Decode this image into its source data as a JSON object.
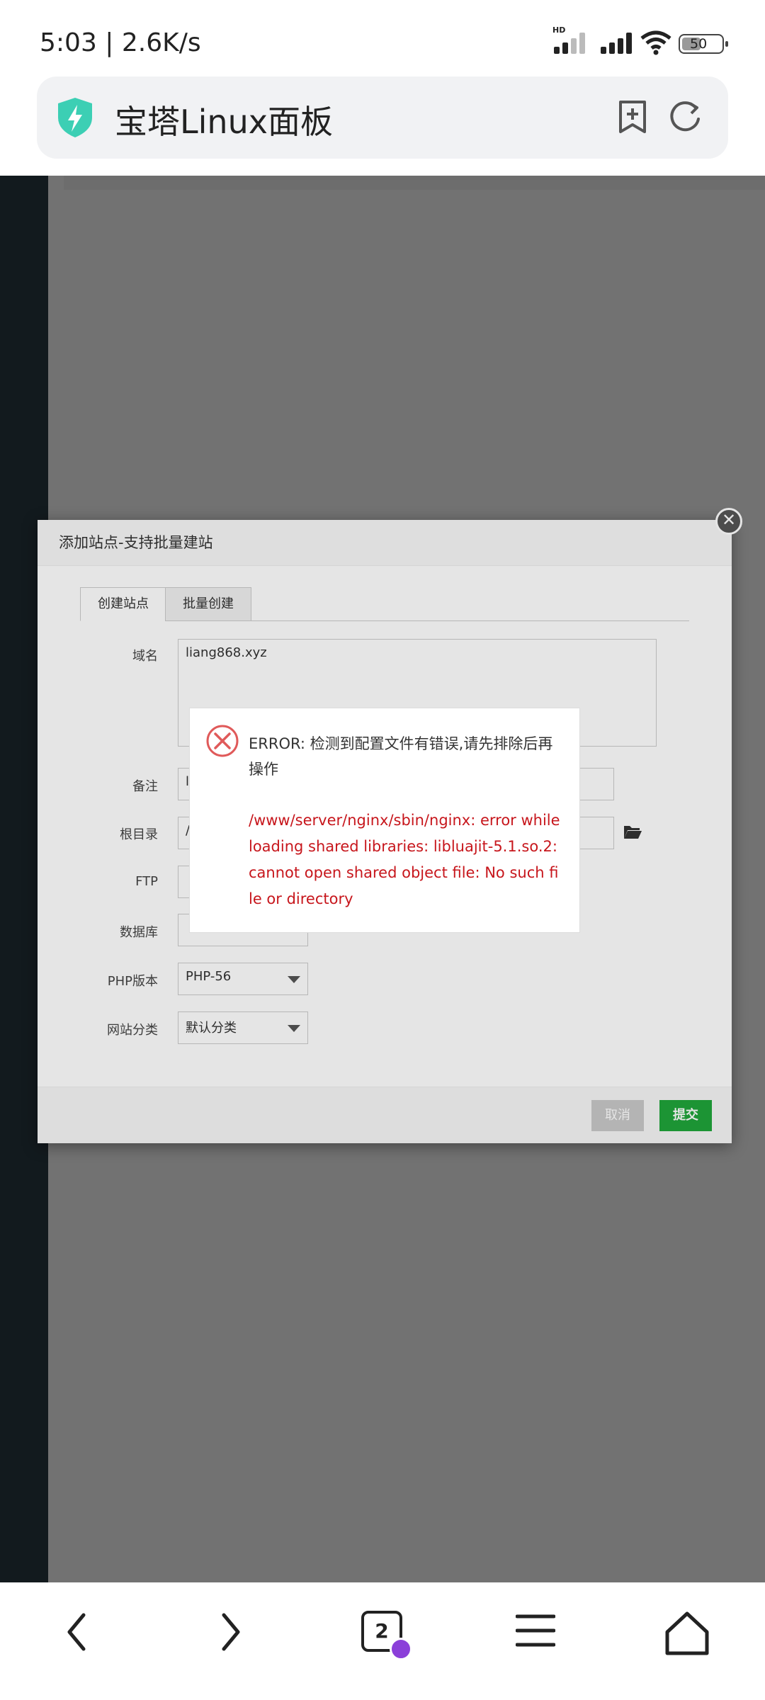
{
  "status_bar": {
    "time": "5:03 | 2.6K/s",
    "hd_label": "HD",
    "battery": "50",
    "icons": [
      "signal-icon",
      "wifi-icon",
      "battery-icon"
    ]
  },
  "address_bar": {
    "title": "宝塔Linux面板",
    "icons": [
      "shield-icon",
      "bookmark-add-icon",
      "refresh-icon"
    ]
  },
  "dialog": {
    "title": "添加站点-支持批量建站",
    "tabs": [
      "创建站点",
      "批量创建"
    ],
    "fields": {
      "domain": {
        "label": "域名",
        "value": "liang868.xyz"
      },
      "remark": {
        "label": "备注",
        "value": "l"
      },
      "root_dir": {
        "label": "根目录",
        "value": "/"
      },
      "ftp": {
        "label": "FTP",
        "value": ""
      },
      "database": {
        "label": "数据库",
        "value": ""
      },
      "php_version": {
        "label": "PHP版本",
        "value": "PHP-56"
      },
      "site_category": {
        "label": "网站分类",
        "value": "默认分类"
      }
    },
    "buttons": {
      "cancel": "取消",
      "submit": "提交"
    }
  },
  "error_popup": {
    "title": "ERROR: 检测到配置文件有错误,请先排除后再操作",
    "detail": "/www/server/nginx/sbin/nginx: error while loading shared libraries: libluajit-5.1.so.2: cannot open shared object file: No such file or directory"
  },
  "bottom_nav": {
    "tab_count": "2",
    "icons": [
      "back-icon",
      "forward-icon",
      "tabs-icon",
      "menu-icon",
      "home-icon"
    ]
  },
  "colors": {
    "accent_green": "#20a53a",
    "error_red": "#c7161c",
    "shield_teal": "#3ccfb4",
    "incognito_purple": "#8b3fd9"
  }
}
